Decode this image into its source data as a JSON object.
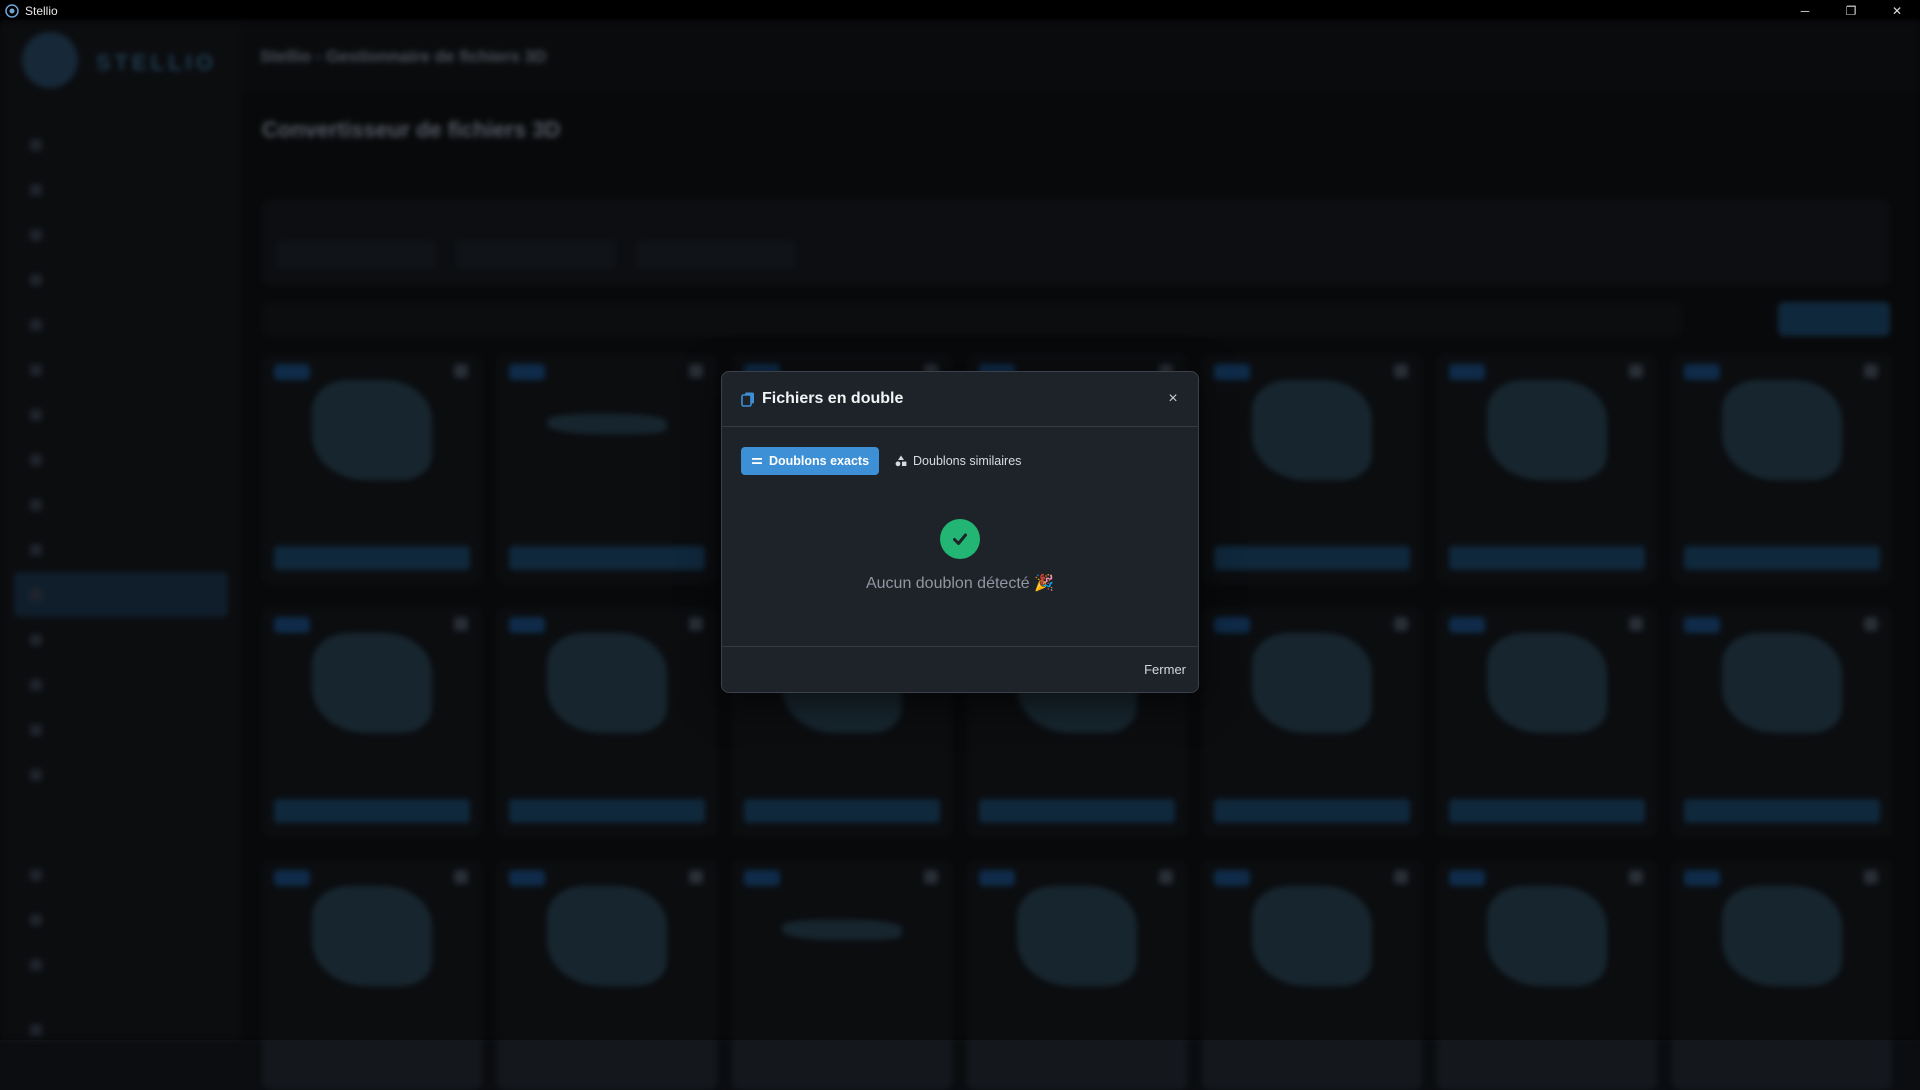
{
  "window": {
    "title": "Stellio",
    "minimize": "─",
    "restore": "❐",
    "close": "✕"
  },
  "background": {
    "header_title": "Stellio - Gestionnaire de fichiers 3D",
    "page_title": "Convertisseur de fichiers 3D",
    "logo_text": "STELLIO"
  },
  "modal": {
    "title": "Fichiers en double",
    "close_icon": "×",
    "tabs": [
      {
        "label": "Doublons exacts",
        "icon": "equals-icon",
        "active": true
      },
      {
        "label": "Doublons similaires",
        "icon": "shapes-icon",
        "active": false
      }
    ],
    "status_icon": "check-circle-icon",
    "message": "Aucun doublon détecté 🎉",
    "footer_button": "Fermer"
  },
  "colors": {
    "accent": "#3d8fd6",
    "success": "#22b573",
    "modal_bg": "#1e2329"
  }
}
